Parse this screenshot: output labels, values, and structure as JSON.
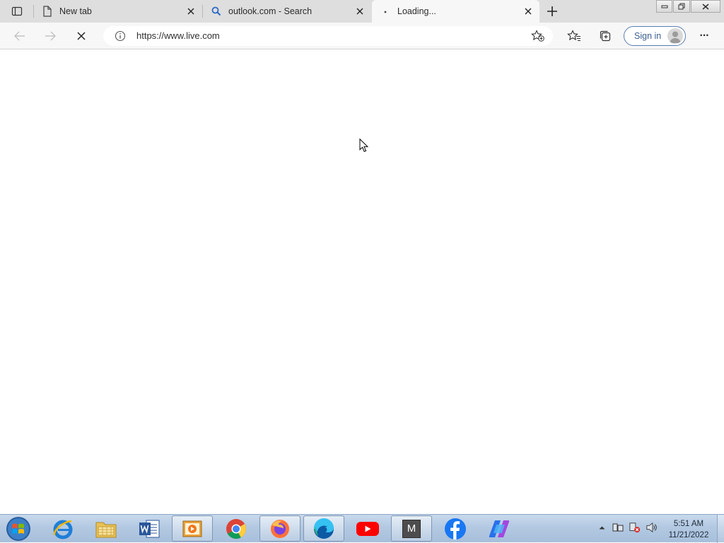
{
  "browser": {
    "tabs": [
      {
        "title": "New tab",
        "icon": "page-icon",
        "active": false
      },
      {
        "title": "outlook.com - Search",
        "icon": "search-icon",
        "active": false
      },
      {
        "title": "Loading...",
        "icon": "loading-dot-icon",
        "active": true
      }
    ],
    "address_bar": {
      "url": "https://www.live.com"
    },
    "toolbar": {
      "sign_in_label": "Sign in",
      "more_label": "···"
    }
  },
  "taskbar": {
    "apps": [
      {
        "name": "internet-explorer",
        "open": false
      },
      {
        "name": "file-explorer",
        "open": false
      },
      {
        "name": "microsoft-word",
        "open": false
      },
      {
        "name": "media-player",
        "open": true
      },
      {
        "name": "google-chrome",
        "open": false
      },
      {
        "name": "firefox",
        "open": true
      },
      {
        "name": "microsoft-edge",
        "open": true
      },
      {
        "name": "youtube",
        "open": false
      },
      {
        "name": "m-app",
        "open": true,
        "letter": "M"
      },
      {
        "name": "facebook",
        "open": false
      },
      {
        "name": "copilot",
        "open": false
      }
    ],
    "clock": {
      "time": "5:51 AM",
      "date": "11/21/2022"
    }
  },
  "colors": {
    "tab_strip": "#dedede",
    "toolbar": "#f7f7f7",
    "accent": "#3a5e91",
    "taskbar": "#b3c9e2"
  }
}
